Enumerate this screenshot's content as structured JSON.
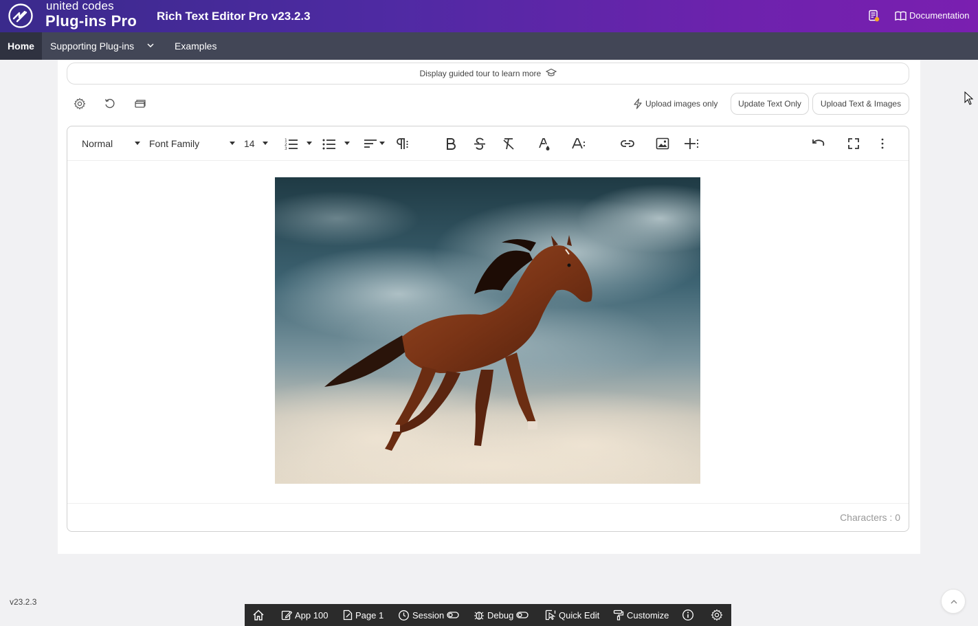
{
  "header": {
    "brand_top": "united codes",
    "brand_bottom": "Plug-ins Pro",
    "app_title": "Rich Text Editor Pro v23.2.3",
    "documentation": "Documentation"
  },
  "nav": {
    "items": [
      {
        "label": "Home"
      },
      {
        "label": "Supporting Plug-ins"
      },
      {
        "label": "Examples"
      }
    ]
  },
  "tour": {
    "label": "Display guided tour to learn more"
  },
  "actions": {
    "upload_images_only": "Upload images only",
    "update_text_only": "Update Text Only",
    "upload_text_images": "Upload Text & Images"
  },
  "editor": {
    "paragraph_style": "Normal",
    "font_family": "Font Family",
    "font_size": "14",
    "characters_label": "Characters : 0"
  },
  "footer": {
    "version": "v23.2.3"
  },
  "devbar": {
    "app": "App 100",
    "page": "Page 1",
    "session": "Session",
    "debug": "Debug",
    "quick_edit": "Quick Edit",
    "customize": "Customize"
  },
  "colors": {
    "header_start": "#3a2a8c",
    "header_end": "#7a1fb0",
    "nav": "#424656",
    "devbar": "#2b2b2b"
  }
}
